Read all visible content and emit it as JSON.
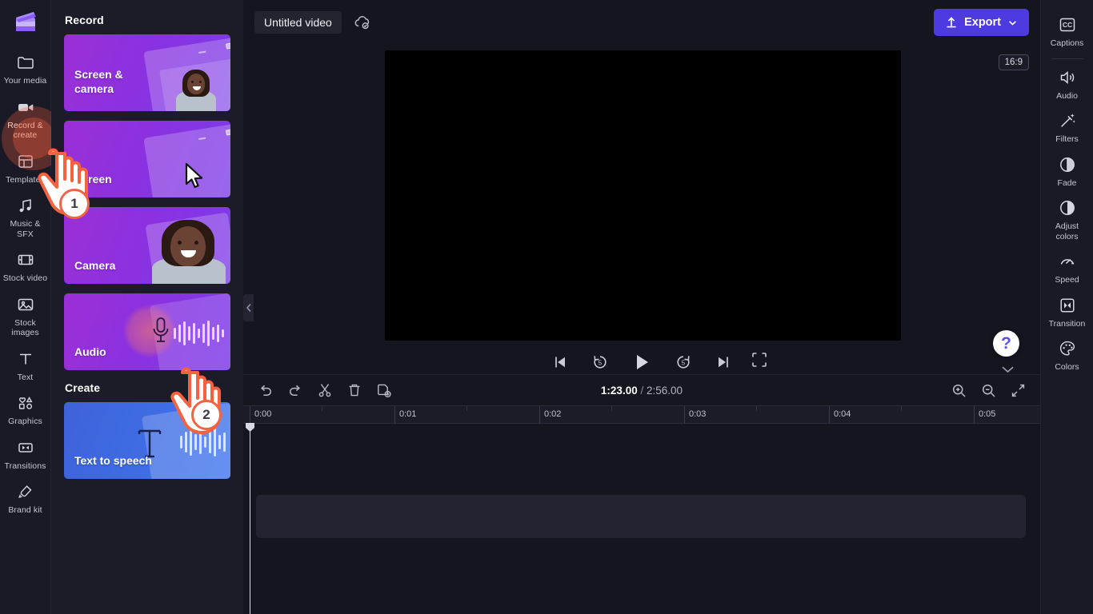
{
  "app": {
    "logo_icon": "clipchamp-logo-icon"
  },
  "left_rail": {
    "items": [
      {
        "label": "Your media",
        "icon": "folder-icon",
        "active": false
      },
      {
        "label": "Record\n& create",
        "icon": "video-camera-icon",
        "active": true
      },
      {
        "label": "Templates",
        "icon": "grid-template-icon",
        "active": false
      },
      {
        "label": "Music & SFX",
        "icon": "music-note-icon",
        "active": false
      },
      {
        "label": "Stock video",
        "icon": "film-strip-icon",
        "active": false
      },
      {
        "label": "Stock\nimages",
        "icon": "image-icon",
        "active": false
      },
      {
        "label": "Text",
        "icon": "text-t-icon",
        "active": false
      },
      {
        "label": "Graphics",
        "icon": "shapes-icon",
        "active": false
      },
      {
        "label": "Transitions",
        "icon": "transition-icon",
        "active": false
      },
      {
        "label": "Brand kit",
        "icon": "brand-kit-icon",
        "active": false
      }
    ]
  },
  "panel": {
    "record_heading": "Record",
    "create_heading": "Create",
    "record_cards": [
      {
        "label": "Screen &\ncamera",
        "name": "screen-and-camera-card"
      },
      {
        "label": "Screen",
        "name": "screen-card"
      },
      {
        "label": "Camera",
        "name": "camera-card"
      },
      {
        "label": "Audio",
        "name": "audio-card"
      }
    ],
    "create_cards": [
      {
        "label": "Text to speech",
        "name": "text-to-speech-card"
      }
    ],
    "collapse_icon": "chevron-left-icon"
  },
  "annotations": {
    "steps": [
      {
        "number": "1"
      },
      {
        "number": "2"
      }
    ]
  },
  "topbar": {
    "project_title": "Untitled video",
    "save_status_icon": "cloud-check-icon",
    "export_label": "Export",
    "export_icon": "upload-icon",
    "export_chevron_icon": "chevron-down-icon"
  },
  "preview": {
    "aspect_ratio": "16:9",
    "controls": [
      {
        "name": "skip-to-start-button",
        "icon": "skip-back-icon"
      },
      {
        "name": "rewind-5-button",
        "icon": "rewind-5-icon"
      },
      {
        "name": "play-button",
        "icon": "play-icon"
      },
      {
        "name": "forward-5-button",
        "icon": "forward-5-icon"
      },
      {
        "name": "skip-to-end-button",
        "icon": "skip-forward-icon"
      }
    ],
    "fullscreen_icon": "fullscreen-icon",
    "help_label": "?",
    "collapse_preview_icon": "chevron-down-icon"
  },
  "timeline": {
    "tools": [
      {
        "name": "undo-button",
        "icon": "undo-icon"
      },
      {
        "name": "redo-button",
        "icon": "redo-icon"
      },
      {
        "name": "split-button",
        "icon": "scissors-icon"
      },
      {
        "name": "delete-button",
        "icon": "trash-icon"
      },
      {
        "name": "duplicate-button",
        "icon": "duplicate-icon"
      }
    ],
    "current_time": "1:23.00",
    "separator": "/",
    "total_time": "2:56.00",
    "zoom_in_icon": "zoom-in-icon",
    "zoom_out_icon": "zoom-out-icon",
    "fit_icon": "fit-to-screen-icon",
    "ruler_ticks": [
      "0:00",
      "0:01",
      "0:02",
      "0:03",
      "0:04",
      "0:05"
    ]
  },
  "right_rail": {
    "items": [
      {
        "label": "Captions",
        "icon": "captions-cc-icon"
      },
      {
        "label": "Audio",
        "icon": "speaker-icon"
      },
      {
        "label": "Filters",
        "icon": "magic-wand-icon"
      },
      {
        "label": "Fade",
        "icon": "fade-circle-icon"
      },
      {
        "label": "Adjust\ncolors",
        "icon": "contrast-circle-icon"
      },
      {
        "label": "Speed",
        "icon": "speedometer-icon"
      },
      {
        "label": "Transition",
        "icon": "transition-square-icon"
      },
      {
        "label": "Colors",
        "icon": "palette-icon"
      }
    ]
  },
  "colors": {
    "accent": "#4d3ae0",
    "card_purple": "#8b31e0",
    "card_blue": "#3f6ce4",
    "highlight_orange": "#f4623f",
    "panel_bg": "#1b1c28",
    "rail_bg": "#191a26",
    "canvas_bg": "#14151f"
  }
}
